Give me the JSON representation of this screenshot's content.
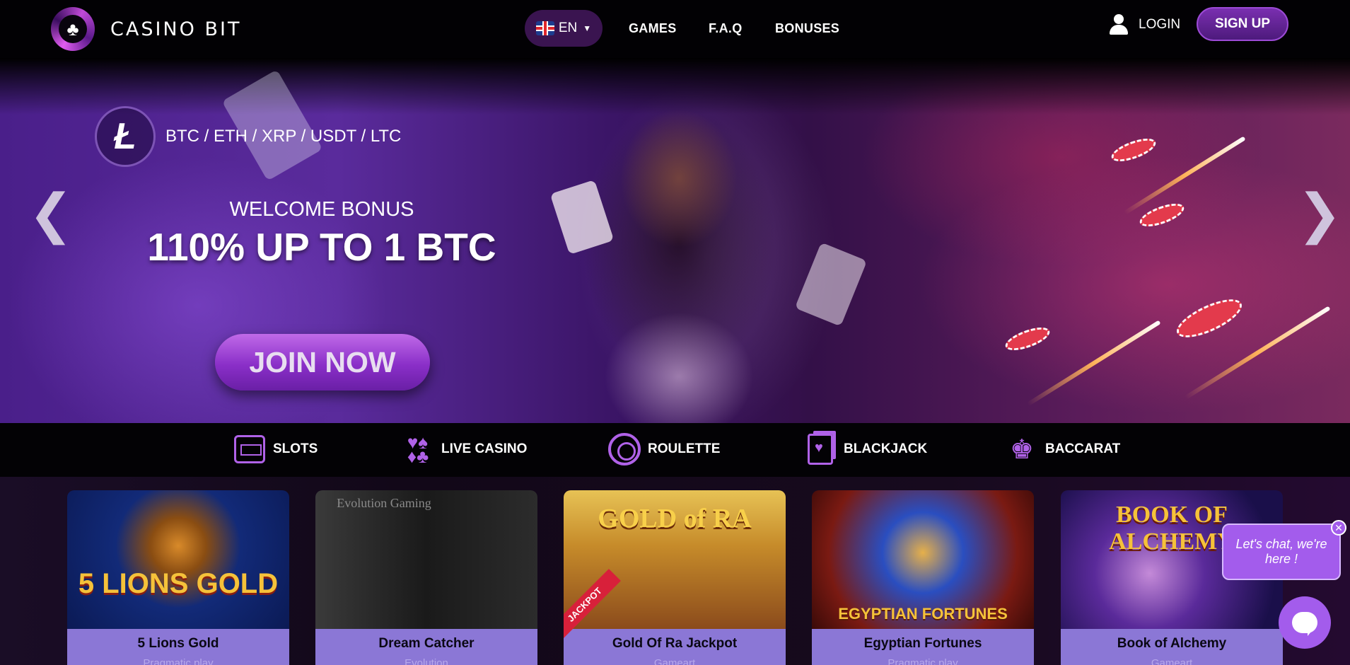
{
  "header": {
    "logo_text": "CASINO BIT",
    "language": "EN",
    "nav": [
      "GAMES",
      "F.A.Q",
      "BONUSES"
    ],
    "login_label": "LOGIN",
    "signup_label": "SIGN UP"
  },
  "hero": {
    "crypto_symbol": "Ł",
    "cryptos": "BTC / ETH / XRP / USDT / LTC",
    "welcome": "WELCOME BONUS",
    "headline": "110% UP TO 1 BTC",
    "cta": "JOIN NOW",
    "prev_arrow": "❮",
    "next_arrow": "❯"
  },
  "categories": [
    {
      "label": "SLOTS",
      "icon": "slot-machine-icon"
    },
    {
      "label": "LIVE CASINO",
      "icon": "card-suits-icon"
    },
    {
      "label": "ROULETTE",
      "icon": "roulette-icon"
    },
    {
      "label": "BLACKJACK",
      "icon": "playing-card-icon"
    },
    {
      "label": "BACCARAT",
      "icon": "dealer-icon"
    }
  ],
  "games": [
    {
      "title": "5 Lions Gold",
      "provider": "Pragmatic play",
      "art": "5 LIONS GOLD"
    },
    {
      "title": "Dream Catcher",
      "provider": "Evolution",
      "art": "Evolution Gaming"
    },
    {
      "title": "Gold Of Ra Jackpot",
      "provider": "Gameart",
      "art": "GOLD of RA",
      "ribbon": "JACKPOT"
    },
    {
      "title": "Egyptian Fortunes",
      "provider": "Pragmatic play",
      "art": "EGYPTIAN FORTUNES"
    },
    {
      "title": "Book of Alchemy",
      "provider": "Gameart",
      "art": "BOOK OF ALCHEMY"
    }
  ],
  "chat": {
    "message": "Let's chat, we're here !",
    "close": "✕"
  },
  "colors": {
    "accent": "#a35cec",
    "card_footer": "#8b77d6",
    "header_bg": "#020104"
  }
}
